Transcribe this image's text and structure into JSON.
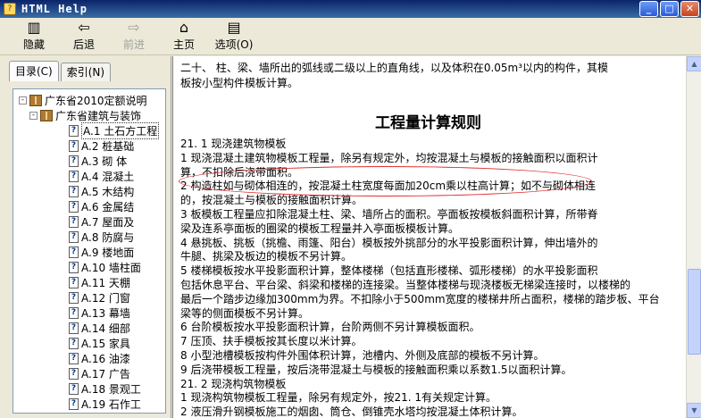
{
  "window": {
    "title": "HTML Help"
  },
  "toolbar": {
    "buttons": [
      {
        "label": "隐藏",
        "icon": "hide-icon",
        "enabled": true
      },
      {
        "label": "后退",
        "icon": "back-arrow-icon",
        "enabled": true
      },
      {
        "label": "前进",
        "icon": "forward-arrow-icon",
        "enabled": false
      },
      {
        "label": "主页",
        "icon": "home-icon",
        "enabled": true
      },
      {
        "label": "选项(O)",
        "icon": "options-icon",
        "enabled": true
      }
    ]
  },
  "leftpane": {
    "tabs": [
      {
        "label": "目录(C)",
        "active": true
      },
      {
        "label": "索引(N)",
        "active": false
      }
    ],
    "tree": [
      {
        "level": 0,
        "kind": "book",
        "expander": "-",
        "label": "广东省2010定额说明"
      },
      {
        "level": 1,
        "kind": "book",
        "expander": "-",
        "label": "广东省建筑与装饰"
      },
      {
        "level": 2,
        "kind": "topic",
        "label": "A.1  土石方工程",
        "selected": true
      },
      {
        "level": 2,
        "kind": "topic",
        "label": "A.2  桩基础"
      },
      {
        "level": 2,
        "kind": "topic",
        "label": "A.3  砌  体"
      },
      {
        "level": 2,
        "kind": "topic",
        "label": "A.4  混凝土"
      },
      {
        "level": 2,
        "kind": "topic",
        "label": "A.5  木结构"
      },
      {
        "level": 2,
        "kind": "topic",
        "label": "A.6  金属结"
      },
      {
        "level": 2,
        "kind": "topic",
        "label": "A.7  屋面及"
      },
      {
        "level": 2,
        "kind": "topic",
        "label": "A.8  防腐与"
      },
      {
        "level": 2,
        "kind": "topic",
        "label": "A.9  楼地面"
      },
      {
        "level": 2,
        "kind": "topic",
        "label": "A.10  墙柱面"
      },
      {
        "level": 2,
        "kind": "topic",
        "label": "A.11  天棚"
      },
      {
        "level": 2,
        "kind": "topic",
        "label": "A.12  门窗"
      },
      {
        "level": 2,
        "kind": "topic",
        "label": "A.13  幕墙"
      },
      {
        "level": 2,
        "kind": "topic",
        "label": "A.14  细部"
      },
      {
        "level": 2,
        "kind": "topic",
        "label": "A.15  家具"
      },
      {
        "level": 2,
        "kind": "topic",
        "label": "A.16  油漆"
      },
      {
        "level": 2,
        "kind": "topic",
        "label": "A.17  广告"
      },
      {
        "level": 2,
        "kind": "topic",
        "label": "A.18  景观工"
      },
      {
        "level": 2,
        "kind": "topic",
        "label": "A.19  石作工"
      }
    ]
  },
  "content": {
    "top_lines": [
      "        二十、   柱、梁、墙所出的弧线或二级以上的直角线，以及体积在0.05m³以内的构件，其模",
      "板按小型构件模板计算。"
    ],
    "heading": "工程量计算规则",
    "body_lines": [
      "21. 1   现浇建筑物模板",
      "    1   现浇混凝土建筑物模板工程量，除另有规定外，均按混凝土与模板的接触面积以面积计",
      "算，不扣除后浇带面积。",
      "    2   构造柱如与砌体相连的，按混凝土柱宽度每面加20cm乘以柱高计算；如不与砌体相连",
      "的，按混凝土与模板的接触面积计算。",
      "    3   板模板工程量应扣除混凝土柱、梁、墙所占的面积。亭面板按模板斜面积计算，所带脊",
      "梁及连系亭面板的圈梁的模板工程量并入亭面板模板计算。",
      "    4   悬挑板、挑板（挑檐、雨篷、阳台）模板按外挑部分的水平投影面积计算，伸出墙外的",
      "牛腿、挑梁及板边的模板不另计算。",
      "    5   楼梯模板按水平投影面积计算，整体楼梯（包括直形楼梯、弧形楼梯）的水平投影面积",
      "包括休息平台、平台梁、斜梁和楼梯的连接梁。当整体楼梯与现浇楼板无梯梁连接时，以楼梯的",
      "最后一个踏步边缘加300mm为界。不扣除小于500mm宽度的楼梯井所占面积，楼梯的踏步板、平台",
      "梁等的侧面模板不另计算。",
      "    6   台阶模板按水平投影面积计算，台阶两侧不另计算模板面积。",
      "    7   压顶、扶手模板按其长度以米计算。",
      "    8   小型池槽模板按构件外围体积计算，池槽内、外侧及底部的模板不另计算。",
      "    9   后浇带模板工程量，按后浇带混凝土与模板的接触面积乘以系数1.5以面积计算。",
      "21. 2   现浇构筑物模板",
      "    1   现浇构筑物模板工程量，除另有规定外，按21. 1有关规定计算。",
      "    2   液压滑升钢模板施工的烟囱、筒仓、倒锥壳水塔均按混凝土体积计算。"
    ]
  }
}
